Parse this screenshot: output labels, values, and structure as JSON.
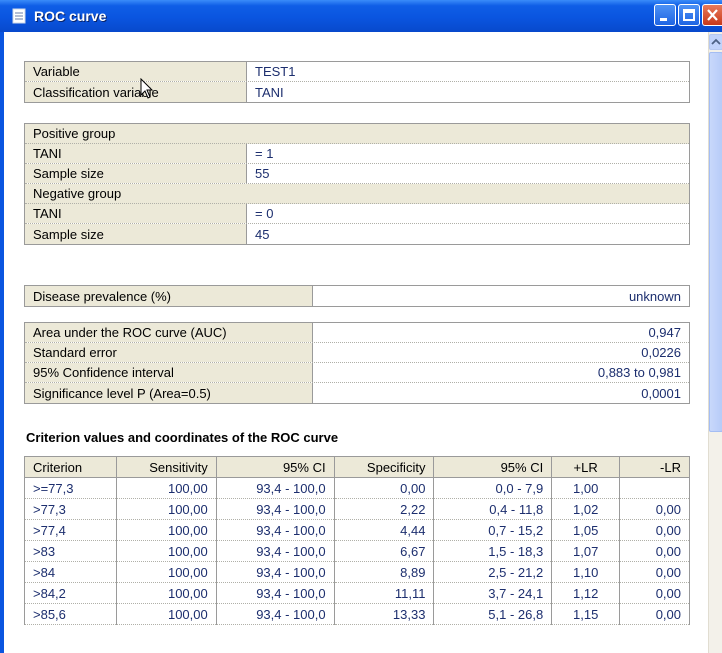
{
  "window": {
    "title": "ROC curve"
  },
  "variables": [
    {
      "label": "Variable",
      "value": "TEST1"
    },
    {
      "label": "Classification variable",
      "value": "TANI"
    }
  ],
  "groups": {
    "positive": {
      "title": "Positive group",
      "var_label": "TANI",
      "var_value": "= 1",
      "size_label": "Sample size",
      "size_value": "55"
    },
    "negative": {
      "title": "Negative group",
      "var_label": "TANI",
      "var_value": "= 0",
      "size_label": "Sample size",
      "size_value": "45"
    }
  },
  "prevalence": {
    "label": "Disease prevalence (%)",
    "value": "unknown"
  },
  "stats": [
    {
      "label": "Area under the ROC curve (AUC)",
      "value": "0,947"
    },
    {
      "label": "Standard error",
      "value": "0,0226"
    },
    {
      "label": "95% Confidence interval",
      "value": "0,883 to 0,981"
    },
    {
      "label": "Significance level P (Area=0.5)",
      "value": "0,0001"
    }
  ],
  "criterion_section": {
    "title": "Criterion values and coordinates of the ROC curve",
    "headers": [
      "Criterion",
      "Sensitivity",
      "95% CI",
      "Specificity",
      "95% CI",
      "+LR",
      "-LR"
    ],
    "rows": [
      [
        ">=77,3",
        "100,00",
        "93,4 - 100,0",
        "0,00",
        "0,0 - 7,9",
        "1,00",
        ""
      ],
      [
        ">77,3",
        "100,00",
        "93,4 - 100,0",
        "2,22",
        "0,4 - 11,8",
        "1,02",
        "0,00"
      ],
      [
        ">77,4",
        "100,00",
        "93,4 - 100,0",
        "4,44",
        "0,7 - 15,2",
        "1,05",
        "0,00"
      ],
      [
        ">83",
        "100,00",
        "93,4 - 100,0",
        "6,67",
        "1,5 - 18,3",
        "1,07",
        "0,00"
      ],
      [
        ">84",
        "100,00",
        "93,4 - 100,0",
        "8,89",
        "2,5 - 21,2",
        "1,10",
        "0,00"
      ],
      [
        ">84,2",
        "100,00",
        "93,4 - 100,0",
        "11,11",
        "3,7 - 24,1",
        "1,12",
        "0,00"
      ],
      [
        ">85,6",
        "100,00",
        "93,4 - 100,0",
        "13,33",
        "5,1 - 26,8",
        "1,15",
        "0,00"
      ]
    ]
  },
  "colors": {
    "titlebar": "#0a55e0",
    "label_bg": "#ece9d8",
    "value_text": "#1c2e6e"
  },
  "icons": {
    "window": "document-icon",
    "minimize": "minimize-icon",
    "maximize": "maximize-icon",
    "close": "close-icon"
  }
}
